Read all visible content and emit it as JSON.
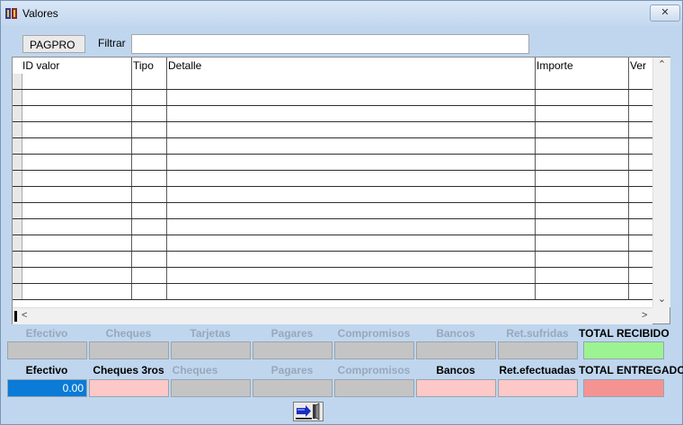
{
  "window": {
    "title": "Valores",
    "close_glyph": "✕"
  },
  "header": {
    "code": "PAGPRO",
    "filter_label": "Filtrar",
    "filter_value": ""
  },
  "grid": {
    "columns": [
      "ID valor",
      "Tipo",
      "Detalle",
      "Importe",
      "Ver"
    ],
    "row_count": 14,
    "scroll_up": "⌃",
    "scroll_down": "⌄",
    "scroll_left": "<",
    "scroll_right": ">"
  },
  "recibido": {
    "labels": [
      "Efectivo",
      "Cheques",
      "Tarjetas",
      "Pagares",
      "Compromisos",
      "Bancos",
      "Ret.sufridas",
      "TOTAL RECIBIDO"
    ],
    "values": [
      "",
      "",
      "",
      "",
      "",
      "",
      "",
      ""
    ]
  },
  "entregado": {
    "labels": [
      "Efectivo",
      "Cheques 3ros",
      "Cheques",
      "Pagares",
      "Compromisos",
      "Bancos",
      "Ret.efectuadas",
      "TOTAL ENTREGADO"
    ],
    "values": [
      "0.00",
      "",
      "",
      "",
      "",
      "",
      "",
      ""
    ]
  },
  "colors": {
    "total_recibido": "#9cf391",
    "total_entregado": "#f59393",
    "active_pink": "#fcc8c8",
    "disabled_gray": "#c4c4c4",
    "selected_blue": "#0a7bd6"
  },
  "icons": {
    "app": "app-icon",
    "exit": "exit-door-icon"
  }
}
